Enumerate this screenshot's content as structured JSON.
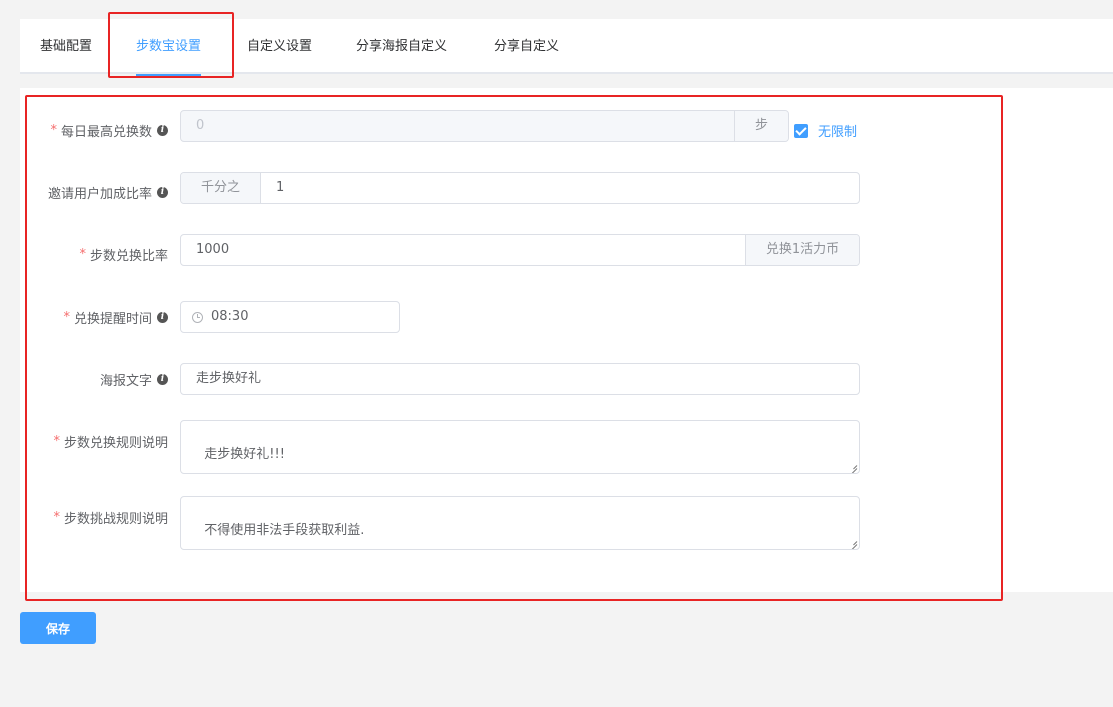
{
  "tabs": [
    {
      "label": "基础配置",
      "active": false
    },
    {
      "label": "步数宝设置",
      "active": true
    },
    {
      "label": "自定义设置",
      "active": false
    },
    {
      "label": "分享海报自定义",
      "active": false
    },
    {
      "label": "分享自定义",
      "active": false
    }
  ],
  "form": {
    "daily_max": {
      "label": "每日最高兑换数",
      "required": true,
      "value": "0",
      "suffix": "步",
      "disabled": true,
      "unlimited_label": "无限制",
      "unlimited_checked": true
    },
    "invite_ratio": {
      "label": "邀请用户加成比率",
      "required": false,
      "prefix": "千分之",
      "value": "1"
    },
    "exchange_ratio": {
      "label": "步数兑换比率",
      "required": true,
      "value": "1000",
      "suffix": "兑换1活力币"
    },
    "remind_time": {
      "label": "兑换提醒时间",
      "required": true,
      "value": "08:30"
    },
    "poster_text": {
      "label": "海报文字",
      "required": false,
      "value": "走步换好礼"
    },
    "exchange_rules": {
      "label": "步数兑换规则说明",
      "required": true,
      "value": "走步换好礼!!!"
    },
    "challenge_rules": {
      "label": "步数挑战规则说明",
      "required": true,
      "value": "不得使用非法手段获取利益."
    }
  },
  "icons": {
    "info": "info-icon",
    "clock": "clock-icon",
    "check": "checkbox-checked-icon"
  },
  "colors": {
    "accent": "#409eff",
    "required": "#f56c6c",
    "highlight_box": "#e82424"
  },
  "save_label": "保存"
}
